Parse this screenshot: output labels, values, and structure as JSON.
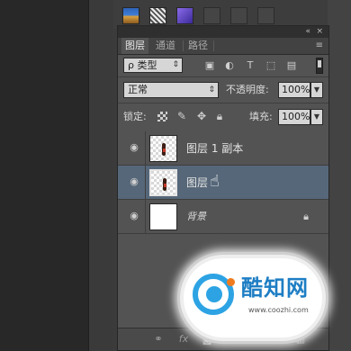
{
  "swatches": [
    {
      "name": "landscape",
      "color": "#3f7ed6"
    },
    {
      "name": "pattern",
      "color": "#888888"
    },
    {
      "name": "purple",
      "color": "#6a4ad0"
    },
    {
      "name": "empty",
      "color": "#454545"
    },
    {
      "name": "empty",
      "color": "#454545"
    },
    {
      "name": "empty",
      "color": "#454545"
    }
  ],
  "panel": {
    "collapse_icon": "«",
    "close_icon": "×",
    "menu_icon": "≡",
    "tabs": [
      {
        "label": "图层",
        "active": true
      },
      {
        "label": "通道",
        "active": false
      },
      {
        "label": "路径",
        "active": false
      }
    ]
  },
  "filter": {
    "kind_label": "ρ 类型",
    "icons": [
      "image-filter-icon",
      "adjustment-filter-icon",
      "type-filter-icon",
      "shape-filter-icon",
      "smart-object-filter-icon"
    ],
    "type_glyph": "T"
  },
  "blend": {
    "mode": "正常",
    "opacity_label": "不透明度:",
    "opacity_value": "100%"
  },
  "lock": {
    "label": "锁定:",
    "fill_label": "填充:",
    "fill_value": "100%"
  },
  "layers": [
    {
      "name": "图层 1 副本",
      "visible": true,
      "selected": false,
      "thumb": "checker-figure",
      "locked": false
    },
    {
      "name": "图层",
      "visible": true,
      "selected": true,
      "thumb": "checker-figure",
      "locked": false
    },
    {
      "name": "背景",
      "visible": true,
      "selected": false,
      "thumb": "white",
      "locked": true
    }
  ],
  "colors": {
    "selection": "#566779",
    "panel": "#535353",
    "watermark_blue": "#2da3e4",
    "watermark_orange": "#f07b1e"
  },
  "watermark": {
    "brand": "酷知网",
    "url": "www.coozhi.com"
  }
}
